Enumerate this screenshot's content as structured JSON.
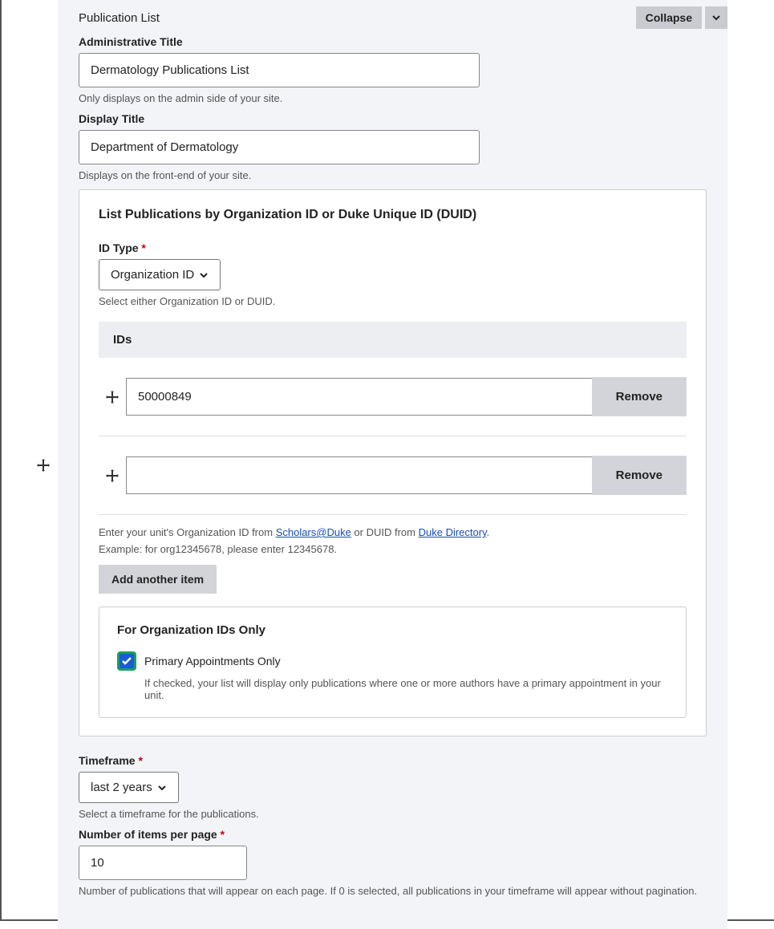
{
  "header": {
    "title": "Publication List",
    "collapse_label": "Collapse"
  },
  "admin_title": {
    "label": "Administrative Title",
    "value": "Dermatology Publications List",
    "help": "Only displays on the admin side of your site."
  },
  "display_title": {
    "label": "Display Title",
    "value": "Department of Dermatology",
    "help": "Displays on the front-end of your site."
  },
  "pub_list": {
    "heading": "List Publications by Organization ID or Duke Unique ID (DUID)",
    "id_type": {
      "label": "ID Type",
      "value": "Organization ID",
      "help": "Select either Organization ID or DUID."
    },
    "ids": {
      "header": "IDs",
      "rows": [
        {
          "value": "50000849",
          "remove": "Remove"
        },
        {
          "value": "",
          "remove": "Remove"
        }
      ],
      "help_prefix": "Enter your unit's Organization ID from ",
      "link1": "Scholars@Duke",
      "help_mid": " or DUID from ",
      "link2": "Duke Directory",
      "help_suffix": ".",
      "example": "Example: for org12345678, please enter 12345678.",
      "add_label": "Add another item"
    },
    "org_only": {
      "heading": "For Organization IDs Only",
      "checkbox_label": "Primary Appointments Only",
      "checkbox_help": "If checked, your list will display only publications where one or more authors have a primary appointment in your unit."
    }
  },
  "timeframe": {
    "label": "Timeframe",
    "value": "last 2 years",
    "help": "Select a timeframe for the publications."
  },
  "per_page": {
    "label": "Number of items per page",
    "value": "10",
    "help": "Number of publications that will appear on each page. If 0 is selected, all publications in your timeframe will appear without pagination."
  }
}
